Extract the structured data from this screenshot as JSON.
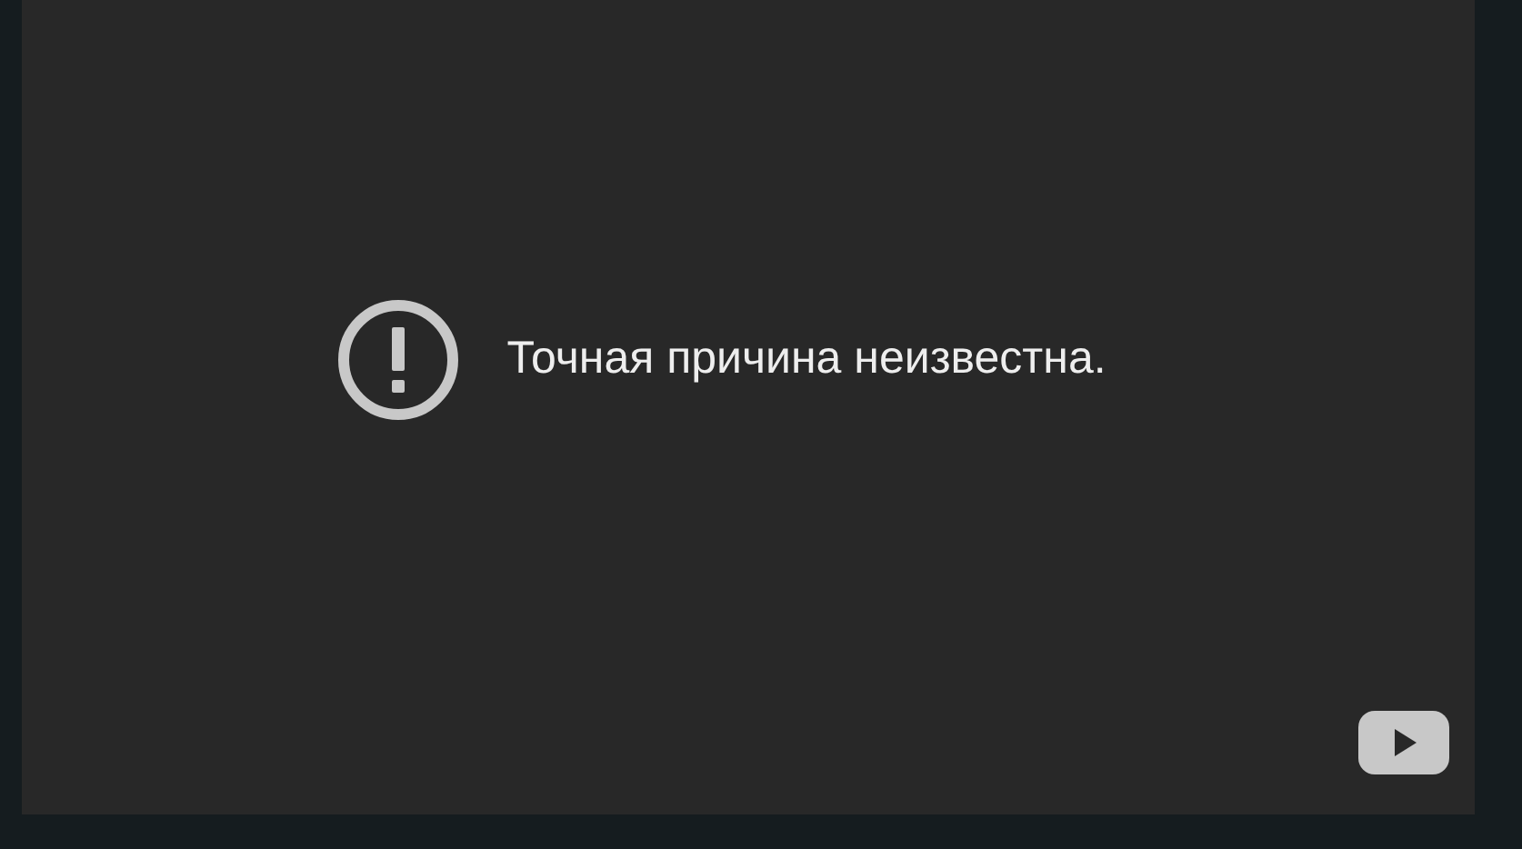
{
  "player": {
    "message": "Точная причина неизвестна."
  }
}
